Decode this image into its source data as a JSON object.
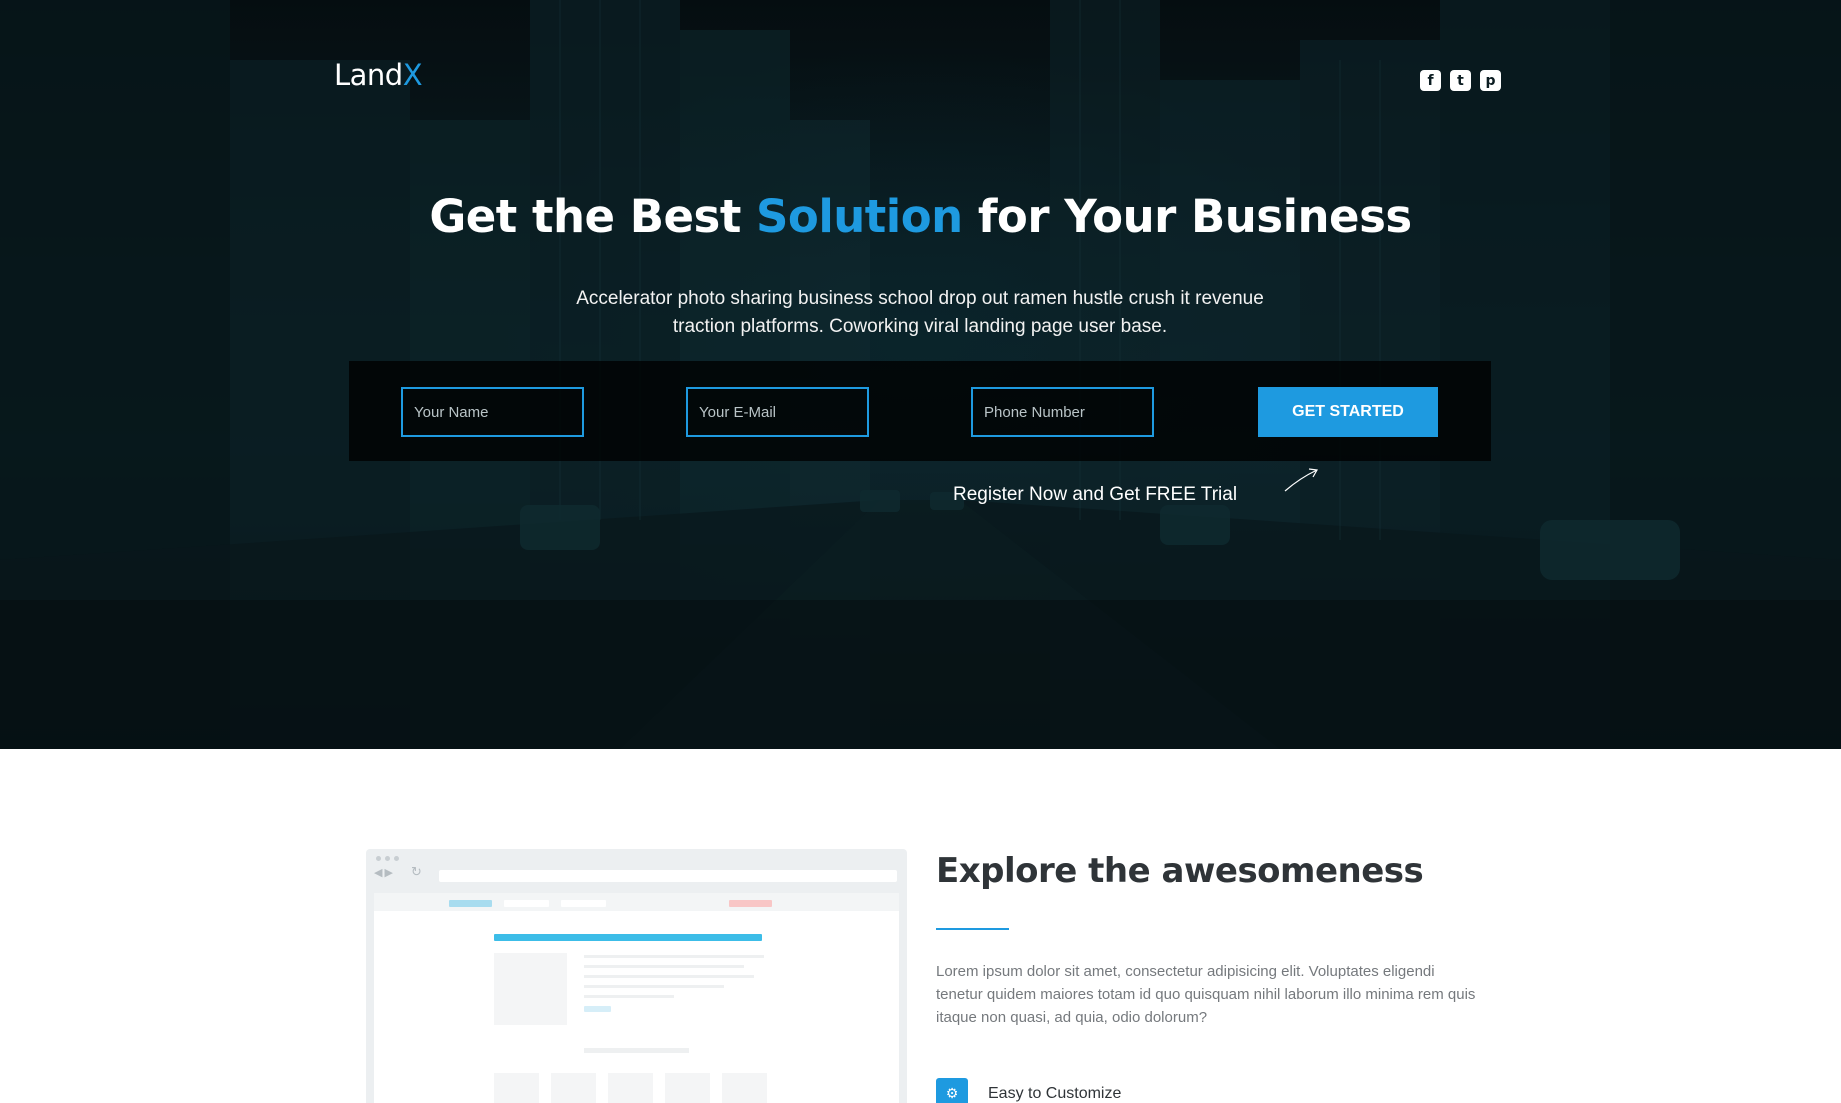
{
  "brand": {
    "logo_main": "Land",
    "logo_accent": "X",
    "accent_color": "#1e9ae0"
  },
  "social": [
    {
      "icon": "facebook-icon",
      "glyph": "f"
    },
    {
      "icon": "twitter-icon",
      "glyph": "t"
    },
    {
      "icon": "pinterest-icon",
      "glyph": "p"
    }
  ],
  "hero": {
    "headline_pre": "Get the Best ",
    "headline_accent": "Solution",
    "headline_post": " for Your Business",
    "subtext": "Accelerator photo sharing business school drop out ramen hustle crush it revenue traction platforms. Coworking viral landing page user base.",
    "form": {
      "name_placeholder": "Your Name",
      "email_placeholder": "Your E-Mail",
      "phone_placeholder": "Phone Number",
      "submit_label": "GET STARTED"
    },
    "trial_note": "Register Now and Get FREE Trial"
  },
  "features": {
    "title": "Explore the awesomeness",
    "body": "Lorem ipsum dolor sit amet, consectetur adipisicing elit. Voluptates eligendi tenetur quidem maiores totam id quo quisquam nihil laborum illo minima rem quis itaque non quasi, ad quia, odio dolorum?",
    "items": [
      {
        "icon": "gear-icon",
        "label": "Easy to Customize"
      }
    ]
  }
}
